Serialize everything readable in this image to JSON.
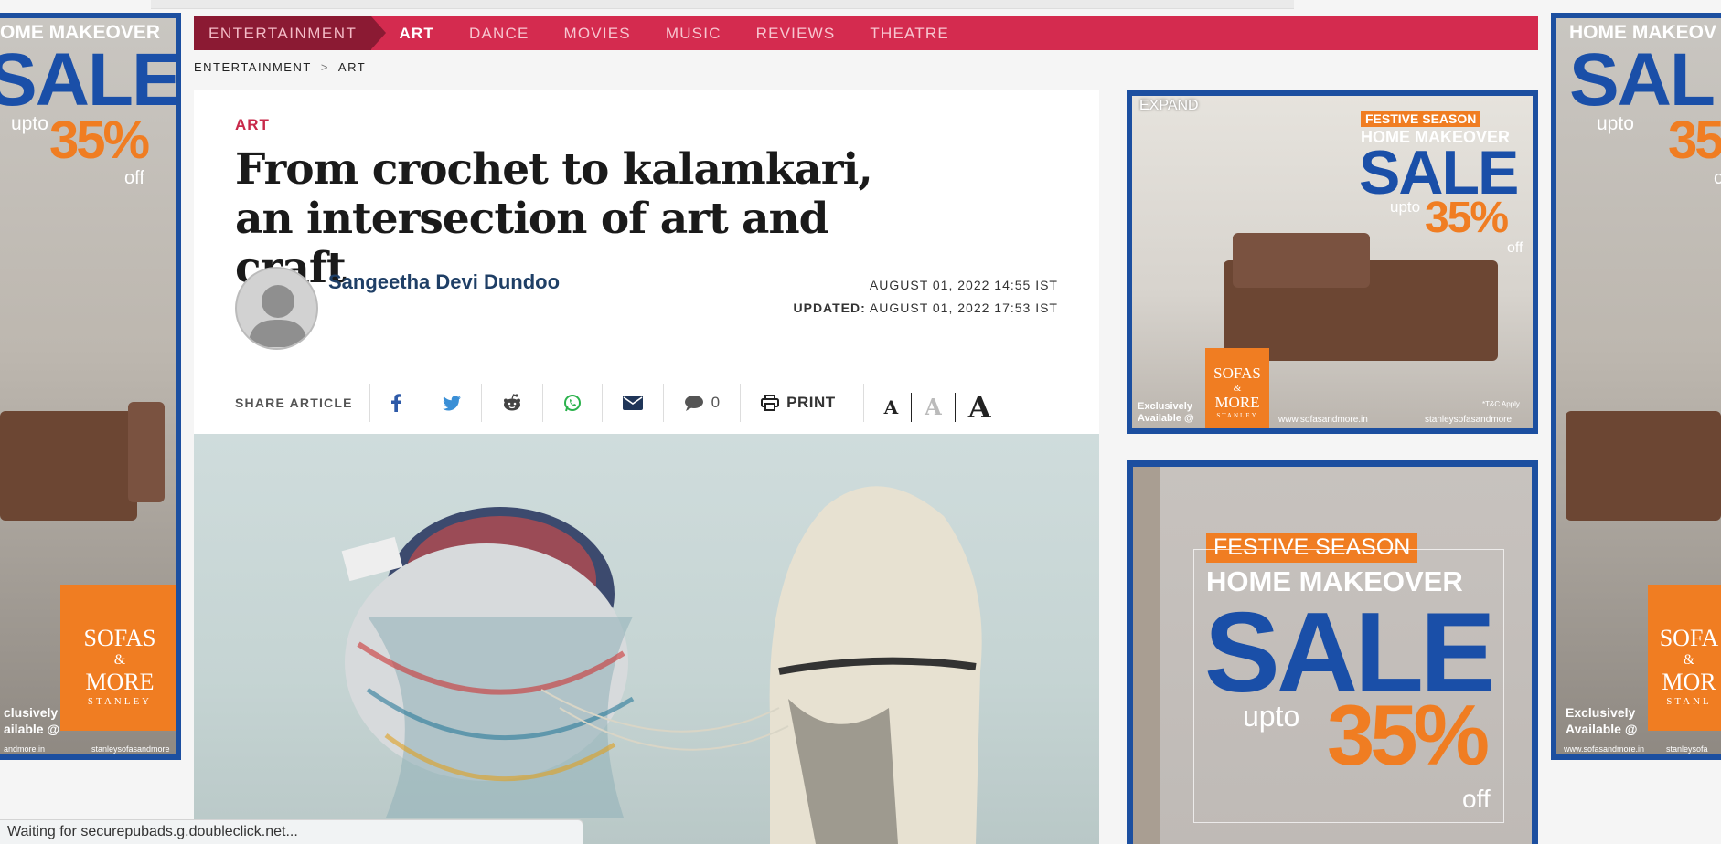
{
  "nav": {
    "section": "ENTERTAINMENT",
    "items": [
      "ART",
      "DANCE",
      "MOVIES",
      "MUSIC",
      "REVIEWS",
      "THEATRE"
    ],
    "active": "ART"
  },
  "breadcrumb": {
    "parent": "ENTERTAINMENT",
    "sep": ">",
    "current": "ART"
  },
  "article": {
    "kicker": "ART",
    "headline": "From crochet to kalamkari, an intersection of art and craft",
    "author": "Sangeetha Devi Dundoo",
    "published": "AUGUST 01, 2022 14:55 IST",
    "updated_label": "UPDATED:",
    "updated": "AUGUST 01, 2022 17:53 IST"
  },
  "share": {
    "label": "SHARE ARTICLE",
    "icons": [
      "facebook-icon",
      "twitter-icon",
      "reddit-icon",
      "whatsapp-icon",
      "email-icon",
      "comment-icon",
      "print-icon"
    ],
    "comment_count": "0",
    "print_label": "PRINT",
    "font_sizes": [
      "A",
      "A",
      "A"
    ]
  },
  "ads": {
    "expand": "EXPAND",
    "festive": "FESTIVE SEASON",
    "home_makeover": "HOME MAKEOVER",
    "sale": "SALE",
    "upto": "upto",
    "percent": "35%",
    "off": "off",
    "logo_line1": "SOFAS",
    "logo_line2": "&",
    "logo_line3": "MORE",
    "logo_line4": "STANLEY",
    "exclusively": "Exclusively",
    "available": "Available @",
    "website": "www.sofasandmore.in",
    "social": "stanleysofasandmore",
    "tnc": "*T&C Apply",
    "side_headline": "OME MAKEOVER",
    "side_headline_right": "HOME MAKEOV",
    "side_sale_right": "SAL",
    "side_pct_right": "35",
    "side_off_right": "o",
    "side_logo_right_1": "SOFA",
    "side_logo_right_3": "MOR",
    "side_logo_right_4": "STANL",
    "side_exclusively_left": "clusively",
    "side_available_left": "ailable @",
    "side_footer_left": "andmore.in",
    "side_footer_right": "www.sofasandmore.in",
    "side_social_right": "stanleysofa"
  },
  "status_bar": "Waiting for securepubads.g.doubleclick.net...",
  "colors": {
    "nav_bg": "#d42b4f",
    "nav_home_bg": "#8b1a33",
    "ad_blue": "#1c4fa0",
    "ad_orange": "#f07d22",
    "kicker": "#c8294a",
    "author": "#1f3f66"
  }
}
